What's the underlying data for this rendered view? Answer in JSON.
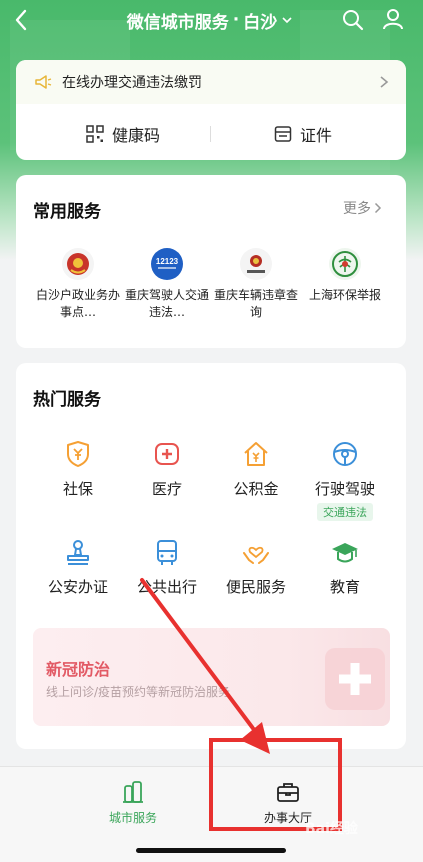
{
  "header": {
    "title": "微信城市服务",
    "separator": "·",
    "city": "白沙"
  },
  "notice": {
    "text": "在线办理交通违法缴罚"
  },
  "quick_actions": [
    {
      "label": "健康码",
      "icon": "qr-code-icon"
    },
    {
      "label": "证件",
      "icon": "card-icon"
    }
  ],
  "common_services": {
    "title": "常用服务",
    "more_label": "更多",
    "items": [
      {
        "label": "白沙户政业务办事点…",
        "icon": "emblem-icon"
      },
      {
        "label": "重庆驾驶人交通违法…",
        "icon": "12123-icon",
        "logo_text": "12123"
      },
      {
        "label": "重庆车辆违章查询",
        "icon": "police-badge-icon"
      },
      {
        "label": "上海环保举报",
        "icon": "eco-emblem-icon"
      }
    ]
  },
  "hot_services": {
    "title": "热门服务",
    "items": [
      {
        "label": "社保",
        "icon": "shield-yuan-icon"
      },
      {
        "label": "医疗",
        "icon": "medical-cross-icon"
      },
      {
        "label": "公积金",
        "icon": "house-yuan-icon"
      },
      {
        "label": "行驶驾驶",
        "icon": "steering-wheel-icon",
        "tag": "交通违法"
      },
      {
        "label": "公安办证",
        "icon": "stamp-icon"
      },
      {
        "label": "公共出行",
        "icon": "bus-icon"
      },
      {
        "label": "便民服务",
        "icon": "heart-hands-icon"
      },
      {
        "label": "教育",
        "icon": "graduation-cap-icon"
      }
    ]
  },
  "banner": {
    "title": "新冠防治",
    "subtitle": "线上问诊/疫苗预约等新冠防治服务"
  },
  "bottom_nav": [
    {
      "label": "城市服务",
      "icon": "city-buildings-icon",
      "active": true
    },
    {
      "label": "办事大厅",
      "icon": "briefcase-icon",
      "active": false
    }
  ],
  "watermark": "Bai经验",
  "colors": {
    "brand_green": "#4cbb6c",
    "highlight_red": "#e8312f",
    "icon_orange": "#f5a034",
    "icon_red": "#e8544f",
    "icon_blue": "#3b8fd9",
    "icon_green": "#3aa55a"
  }
}
